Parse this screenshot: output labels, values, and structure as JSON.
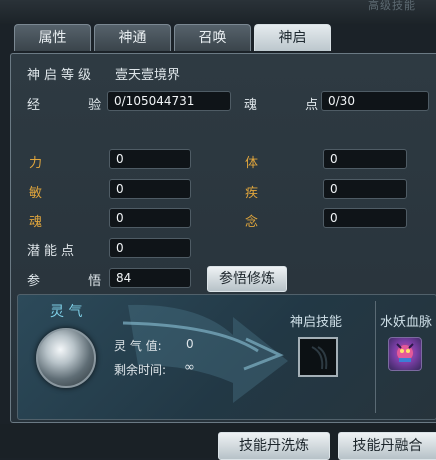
{
  "header": {
    "faded_text": "高级技能"
  },
  "tabs": [
    {
      "label": "属性"
    },
    {
      "label": "神通"
    },
    {
      "label": "召唤"
    },
    {
      "label": "神启",
      "active": true
    }
  ],
  "stats": {
    "level_label": "神启等级",
    "level_value": "壹天壹境界",
    "exp_label": "经 验",
    "exp_value": "0/105044731",
    "soul_points_label": "魂 点",
    "soul_points_value": "0/30",
    "power_label": "力",
    "power_value": "0",
    "body_label": "体",
    "body_value": "0",
    "agility_label": "敏",
    "agility_value": "0",
    "speed_label": "疾",
    "speed_value": "0",
    "soul_label": "魂",
    "soul_value": "0",
    "mind_label": "念",
    "mind_value": "0",
    "potential_label": "潜能点",
    "potential_value": "0",
    "insight_label": "参 悟",
    "insight_value": "84",
    "insight_button": "参悟修炼"
  },
  "lingqi": {
    "title": "灵 气",
    "value_label": "灵 气 值:",
    "value": "0",
    "time_label": "剩余时间:",
    "time_value": "∞",
    "skill_title": "神启技能",
    "pet_title": "水妖血脉"
  },
  "footer": {
    "wash_button": "技能丹洗炼",
    "merge_button": "技能丹融合"
  },
  "colors": {
    "gold_label": "#e0a53c",
    "panel_bg": "#2e3a42",
    "active_tab": "#dfe6ea"
  }
}
